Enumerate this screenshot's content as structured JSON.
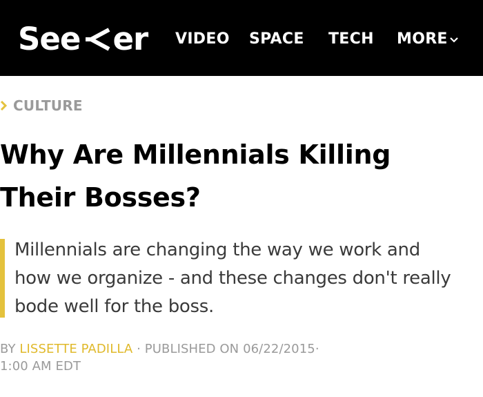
{
  "header": {
    "logo_pre": "See",
    "logo_post": "er",
    "nav": {
      "video": "VIDEO",
      "space": "SPACE",
      "tech": "TECH",
      "more": "MORE"
    }
  },
  "article": {
    "category": "CULTURE",
    "headline_line1": "Why Are Millennials Killing",
    "headline_line2": "Their Bosses?",
    "dek_line1": "Millennials are changing the way we work and",
    "dek_line2": "how we organize - and these changes don't really",
    "dek_line3": "bode well for the boss.",
    "byline": {
      "by": "BY",
      "author": "LISSETTE PADILLA",
      "separator": "·",
      "published": "PUBLISHED ON 06/22/2015",
      "separator2": "·",
      "time": "1:00 AM EDT"
    }
  },
  "colors": {
    "header_bg": "#000000",
    "accent": "#e4c23d",
    "meta_gray": "#9a9a9a"
  },
  "icons": {
    "logo_mark": "k-chevron-icon",
    "more_caret": "chevron-down-icon",
    "crumb_arrow": "chevron-right-icon"
  }
}
